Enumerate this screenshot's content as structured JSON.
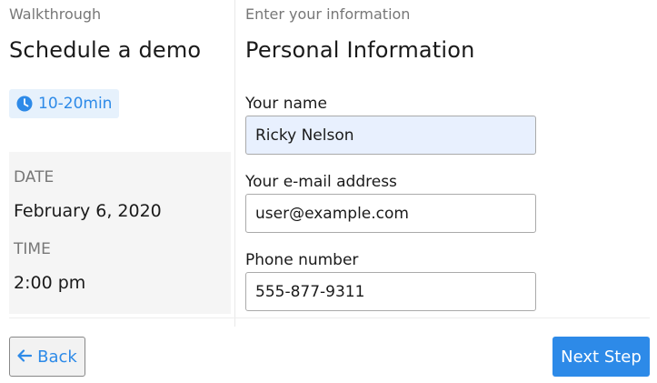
{
  "left": {
    "eyebrow": "Walkthrough",
    "title": "Schedule a demo",
    "duration_badge": {
      "icon": "clock-icon",
      "label": "10-20min"
    },
    "details": {
      "date_label": "DATE",
      "date_value": "February 6, 2020",
      "time_label": "TIME",
      "time_value": "2:00 pm"
    }
  },
  "right": {
    "eyebrow": "Enter your information",
    "title": "Personal Information",
    "fields": {
      "name": {
        "label": "Your name",
        "value": "Ricky Nelson"
      },
      "email": {
        "label": "Your e-mail address",
        "value": "user@example.com"
      },
      "phone": {
        "label": "Phone number",
        "value": "555-877-9311"
      }
    }
  },
  "footer": {
    "back_label": "Back",
    "back_icon": "arrow-left-icon",
    "next_label": "Next Step"
  },
  "colors": {
    "accent": "#2d8ae8",
    "badge_bg": "#e6f1fc",
    "autofill_bg": "#e8f0fe",
    "panel_bg": "#f5f5f5"
  }
}
